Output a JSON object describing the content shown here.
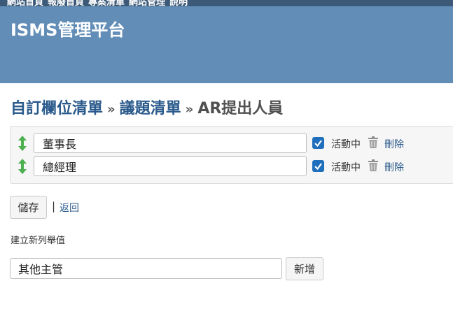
{
  "topbar": {
    "items": [
      "網站首頁",
      "報廢首頁",
      "專案清單",
      "網站管理",
      "說明"
    ]
  },
  "header": {
    "site_title": "ISMS管理平台"
  },
  "breadcrumb": {
    "link1": "自訂欄位清單",
    "sep1": "»",
    "link2": "議題清單",
    "sep2": "»",
    "current": "AR提出人員"
  },
  "values": [
    {
      "value": "董事長",
      "active": true,
      "active_label": "活動中",
      "delete_label": "刪除"
    },
    {
      "value": "總經理",
      "active": true,
      "active_label": "活動中",
      "delete_label": "刪除"
    }
  ],
  "actions": {
    "save_label": "儲存",
    "separator": "|",
    "back_label": "返回"
  },
  "new_value": {
    "label": "建立新列舉值",
    "input_value": "其他主管",
    "add_label": "新增"
  },
  "colors": {
    "topbar": "#3c5a78",
    "header": "#628db6",
    "link": "#2a5a8c",
    "checkbox": "#1f6fbd",
    "handle": "#4caf50"
  },
  "icons": {
    "handle": "up-down-arrow-icon",
    "checkbox": "checkbox-checked-icon",
    "delete": "trash-icon"
  }
}
